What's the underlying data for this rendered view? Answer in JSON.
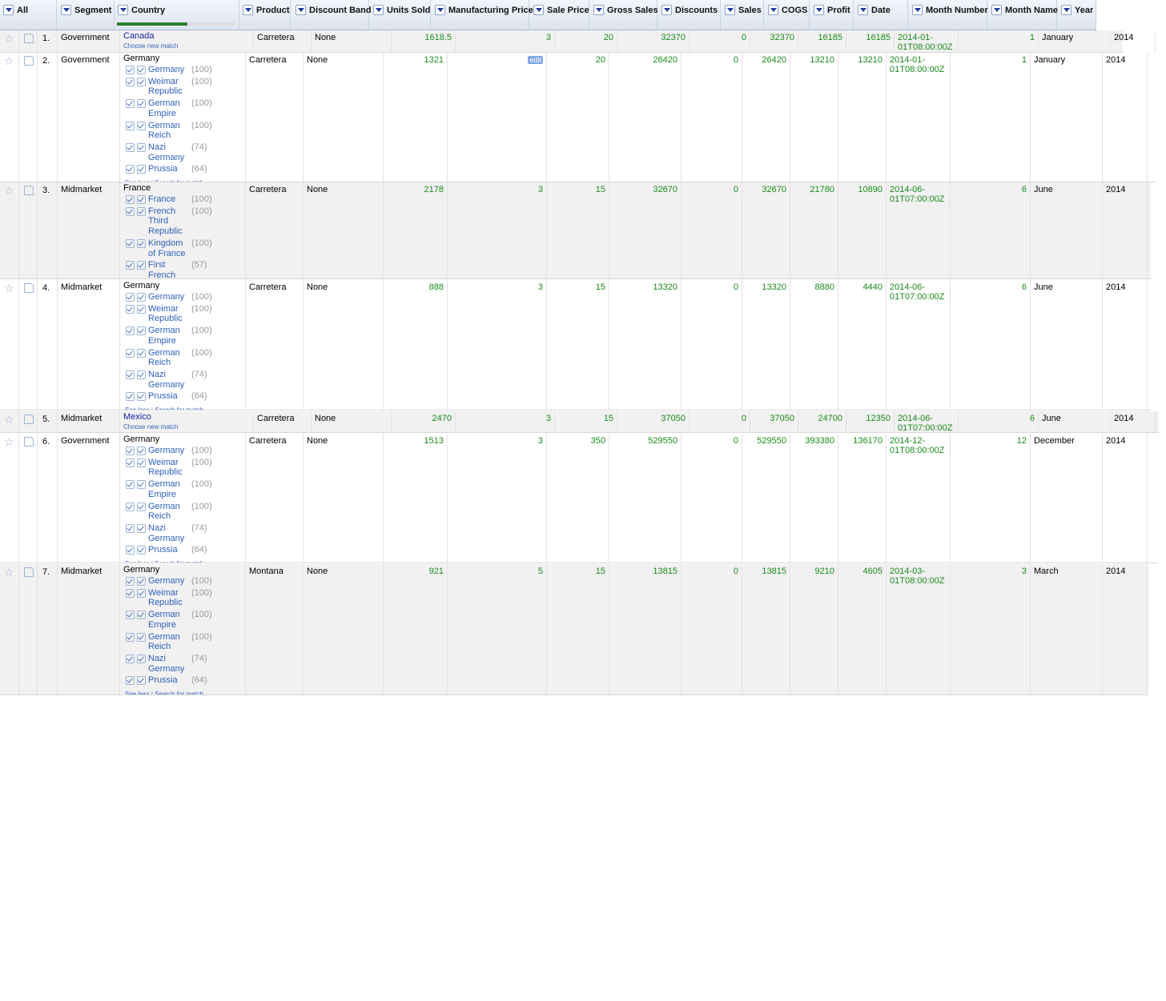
{
  "header": {
    "all": "All",
    "columns": [
      "Segment",
      "Country",
      "Product",
      "Discount Band",
      "Units Sold",
      "Manufacturing Price",
      "Sale Price",
      "Gross Sales",
      "Discounts",
      "Sales",
      "COGS",
      "Profit",
      "Date",
      "Month Number",
      "Month Name",
      "Year"
    ],
    "country_progress": 0.6
  },
  "candidate_links": {
    "see_less": "See less",
    "sep": "|",
    "search": "Search for match",
    "choose_new": "Choose new match"
  },
  "edit_label": "edit",
  "germany_candidates": [
    {
      "name": "Germany",
      "score": "(100)"
    },
    {
      "name": "Weimar Republic",
      "score": "(100)"
    },
    {
      "name": "German Empire",
      "score": "(100)"
    },
    {
      "name": "German Reich",
      "score": "(100)"
    },
    {
      "name": "Nazi Germany",
      "score": "(74)"
    },
    {
      "name": "Prussia",
      "score": "(64)"
    }
  ],
  "france_candidates": [
    {
      "name": "France",
      "score": "(100)"
    },
    {
      "name": "French Third Republic",
      "score": "(100)"
    },
    {
      "name": "Kingdom of France",
      "score": "(100)"
    },
    {
      "name": "First French Empire",
      "score": "(57)"
    }
  ],
  "rows": [
    {
      "idx": "1.",
      "segment": "Government",
      "country": "Canada",
      "country_mode": "matched",
      "product": "Carretera",
      "discount_band": "None",
      "units_sold": "1618.5",
      "mfg_price": "3",
      "sale_price": "20",
      "gross_sales": "32370",
      "discounts": "0",
      "sales": "32370",
      "cogs": "16185",
      "profit": "16185",
      "date": "2014-01-01T08:00:00Z",
      "month_number": "1",
      "month_name": "January",
      "year": "2014"
    },
    {
      "idx": "2.",
      "segment": "Government",
      "country": "Germany",
      "country_mode": "germany",
      "product": "Carretera",
      "discount_band": "None",
      "units_sold": "1321",
      "mfg_price": "",
      "sale_price": "20",
      "gross_sales": "26420",
      "discounts": "0",
      "sales": "26420",
      "cogs": "13210",
      "profit": "13210",
      "date": "2014-01-01T08:00:00Z",
      "month_number": "1",
      "month_name": "January",
      "year": "2014"
    },
    {
      "idx": "3.",
      "segment": "Midmarket",
      "country": "France",
      "country_mode": "france",
      "product": "Carretera",
      "discount_band": "None",
      "units_sold": "2178",
      "mfg_price": "3",
      "sale_price": "15",
      "gross_sales": "32670",
      "discounts": "0",
      "sales": "32670",
      "cogs": "21780",
      "profit": "10890",
      "date": "2014-06-01T07:00:00Z",
      "month_number": "6",
      "month_name": "June",
      "year": "2014"
    },
    {
      "idx": "4.",
      "segment": "Midmarket",
      "country": "Germany",
      "country_mode": "germany",
      "product": "Carretera",
      "discount_band": "None",
      "units_sold": "888",
      "mfg_price": "3",
      "sale_price": "15",
      "gross_sales": "13320",
      "discounts": "0",
      "sales": "13320",
      "cogs": "8880",
      "profit": "4440",
      "date": "2014-06-01T07:00:00Z",
      "month_number": "6",
      "month_name": "June",
      "year": "2014"
    },
    {
      "idx": "5.",
      "segment": "Midmarket",
      "country": "Mexico",
      "country_mode": "matched",
      "product": "Carretera",
      "discount_band": "None",
      "units_sold": "2470",
      "mfg_price": "3",
      "sale_price": "15",
      "gross_sales": "37050",
      "discounts": "0",
      "sales": "37050",
      "cogs": "24700",
      "profit": "12350",
      "date": "2014-06-01T07:00:00Z",
      "month_number": "6",
      "month_name": "June",
      "year": "2014"
    },
    {
      "idx": "6.",
      "segment": "Government",
      "country": "Germany",
      "country_mode": "germany",
      "product": "Carretera",
      "discount_band": "None",
      "units_sold": "1513",
      "mfg_price": "3",
      "sale_price": "350",
      "gross_sales": "529550",
      "discounts": "0",
      "sales": "529550",
      "cogs": "393380",
      "profit": "136170",
      "date": "2014-12-01T08:00:00Z",
      "month_number": "12",
      "month_name": "December",
      "year": "2014"
    },
    {
      "idx": "7.",
      "segment": "Midmarket",
      "country": "Germany",
      "country_mode": "germany",
      "product": "Montana",
      "discount_band": "None",
      "units_sold": "921",
      "mfg_price": "5",
      "sale_price": "15",
      "gross_sales": "13815",
      "discounts": "0",
      "sales": "13815",
      "cogs": "9210",
      "profit": "4605",
      "date": "2014-03-01T08:00:00Z",
      "month_number": "3",
      "month_name": "March",
      "year": "2014"
    }
  ]
}
